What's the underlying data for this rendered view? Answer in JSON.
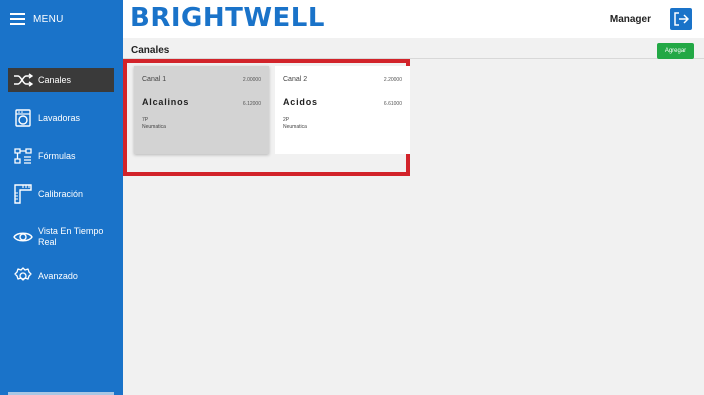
{
  "app": {
    "brand": "BRIGHTWELL",
    "user": "Manager"
  },
  "menu": {
    "label": "MENU"
  },
  "sidebar": {
    "items": [
      {
        "label": "Canales",
        "icon": "shuffle-icon",
        "active": true
      },
      {
        "label": "Lavadoras",
        "icon": "washer-icon",
        "active": false
      },
      {
        "label": "Fórmulas",
        "icon": "formula-icon",
        "active": false
      },
      {
        "label": "Calibración",
        "icon": "ruler-icon",
        "active": false
      },
      {
        "label": "Vista En Tiempo Real",
        "icon": "eye-icon",
        "active": false
      },
      {
        "label": "Avanzado",
        "icon": "gear-icon",
        "active": false
      }
    ]
  },
  "page": {
    "title": "Canales",
    "add_label": "Agregar"
  },
  "cards": [
    {
      "name": "Canal 1",
      "value1": "2.00000",
      "type": "Alcalinos",
      "value2": "6.12000",
      "code": "7P",
      "kind": "Neumatica",
      "selected": true
    },
    {
      "name": "Canal 2",
      "value1": "2.20000",
      "type": "Acidos",
      "value2": "6.61000",
      "code": "2P",
      "kind": "Neumatica",
      "selected": false
    }
  ],
  "colors": {
    "primary": "#1a73c9",
    "active_nav": "#3a3a3a",
    "add_button": "#22a845",
    "highlight": "#d2232a"
  }
}
